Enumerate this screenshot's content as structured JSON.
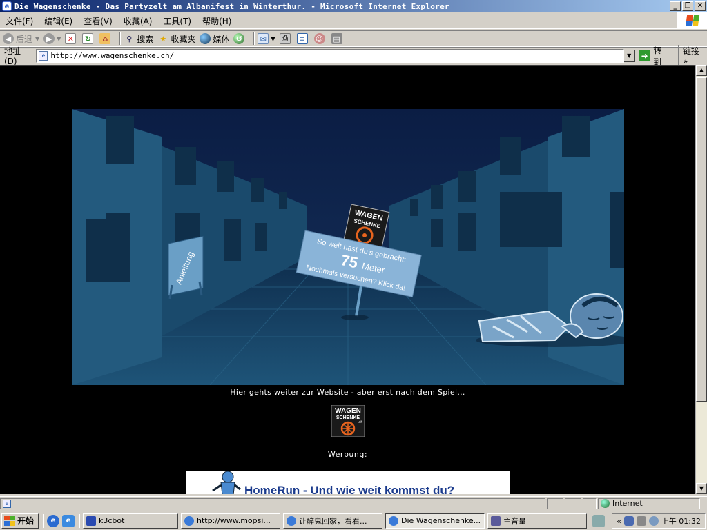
{
  "window": {
    "title": "Die Wagenschenke - Das Partyzelt am Albanifest in Winterthur. - Microsoft Internet Explorer",
    "controls": [
      "_",
      "❐",
      "✕"
    ]
  },
  "menu": [
    "文件(F)",
    "编辑(E)",
    "查看(V)",
    "收藏(A)",
    "工具(T)",
    "帮助(H)"
  ],
  "toolbar": {
    "back": "后退",
    "search": "搜索",
    "favorites": "收藏夹",
    "media": "媒体"
  },
  "address": {
    "label": "地址(D)",
    "url": "http://www.wagenschenke.ch/",
    "go": "转到",
    "links": "链接"
  },
  "game": {
    "sign_line1": "So weit hast du's gebracht:",
    "distance": "75",
    "unit": "Meter",
    "sign_line3": "Nochmals versuchen? Klick da!",
    "instructions": "Anleitung",
    "logo_top": "WAGEN",
    "logo_bottom": "SCHENKE",
    "logo_suffix": ".ch"
  },
  "page": {
    "hint": "Hier gehts weiter zur Website - aber erst nach dem Spiel...",
    "ad_label": "Werbung:",
    "banner": "HomeRun - Und wie weit kommst du?"
  },
  "status": {
    "zone": "Internet"
  },
  "taskbar": {
    "start": "开始",
    "tasks": [
      "k3cbot",
      "http://www.mopsi...",
      "让醉鬼回家，看看...",
      "Die Wagenschenke...",
      "主音量"
    ],
    "active_index": 3,
    "clock": "上午 01:32"
  },
  "colors": {
    "title_start": "#0a246a",
    "title_end": "#a6caf0",
    "sign": "#8ab4d8",
    "logo_orange": "#e8641e"
  }
}
